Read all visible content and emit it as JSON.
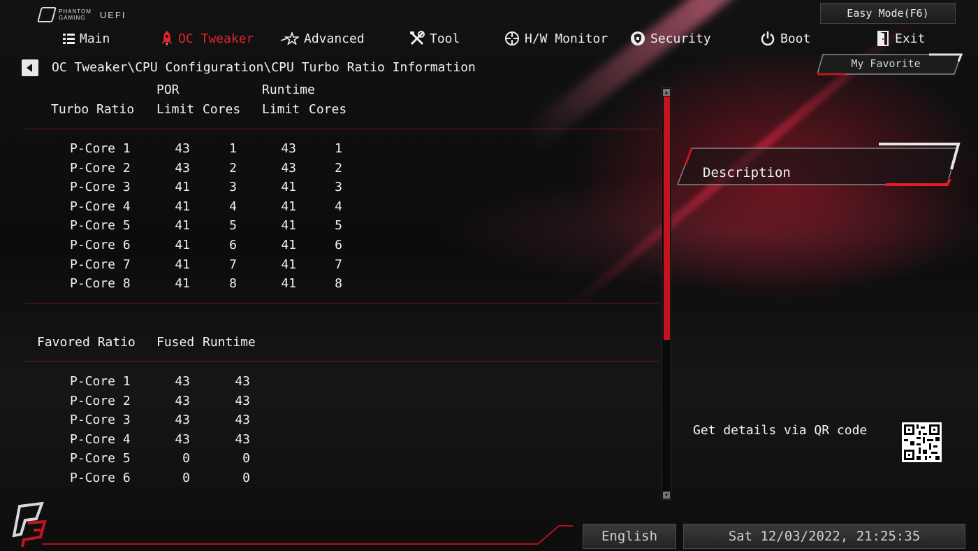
{
  "header": {
    "logo_line1": "PHANTOM",
    "logo_line2": "GAMING",
    "logo_uefi": "UEFI",
    "easy_mode": "Easy Mode(F6)"
  },
  "nav": {
    "tabs": [
      {
        "label": "Main",
        "icon": "list-icon"
      },
      {
        "label": "OC Tweaker",
        "icon": "rocket-icon",
        "active": true
      },
      {
        "label": "Advanced",
        "icon": "star-icon"
      },
      {
        "label": "Tool",
        "icon": "tools-icon"
      },
      {
        "label": "H/W Monitor",
        "icon": "crosshair-icon"
      },
      {
        "label": "Security",
        "icon": "shield-icon"
      },
      {
        "label": "Boot",
        "icon": "power-icon"
      },
      {
        "label": "Exit",
        "icon": "door-icon"
      }
    ]
  },
  "breadcrumb": "OC Tweaker\\CPU Configuration\\CPU Turbo Ratio Information",
  "favorite": "My Favorite",
  "turbo": {
    "group_por": "POR",
    "group_runtime": "Runtime",
    "col_name": "Turbo Ratio",
    "col_limit": "Limit",
    "col_cores": "Cores",
    "col_limit2": "Limit",
    "col_cores2": "Cores",
    "rows": [
      {
        "name": "P-Core 1",
        "por_limit": "43",
        "por_cores": "1",
        "rt_limit": "43",
        "rt_cores": "1"
      },
      {
        "name": "P-Core 2",
        "por_limit": "43",
        "por_cores": "2",
        "rt_limit": "43",
        "rt_cores": "2"
      },
      {
        "name": "P-Core 3",
        "por_limit": "41",
        "por_cores": "3",
        "rt_limit": "41",
        "rt_cores": "3"
      },
      {
        "name": "P-Core 4",
        "por_limit": "41",
        "por_cores": "4",
        "rt_limit": "41",
        "rt_cores": "4"
      },
      {
        "name": "P-Core 5",
        "por_limit": "41",
        "por_cores": "5",
        "rt_limit": "41",
        "rt_cores": "5"
      },
      {
        "name": "P-Core 6",
        "por_limit": "41",
        "por_cores": "6",
        "rt_limit": "41",
        "rt_cores": "6"
      },
      {
        "name": "P-Core 7",
        "por_limit": "41",
        "por_cores": "7",
        "rt_limit": "41",
        "rt_cores": "7"
      },
      {
        "name": "P-Core 8",
        "por_limit": "41",
        "por_cores": "8",
        "rt_limit": "41",
        "rt_cores": "8"
      }
    ]
  },
  "favored": {
    "col_name": "Favored Ratio",
    "col_fused": "Fused",
    "col_runtime": "Runtime",
    "rows": [
      {
        "name": "P-Core 1",
        "fused": "43",
        "runtime": "43"
      },
      {
        "name": "P-Core 2",
        "fused": "43",
        "runtime": "43"
      },
      {
        "name": "P-Core 3",
        "fused": "43",
        "runtime": "43"
      },
      {
        "name": "P-Core 4",
        "fused": "43",
        "runtime": "43"
      },
      {
        "name": "P-Core 5",
        "fused": "0",
        "runtime": "0"
      },
      {
        "name": "P-Core 6",
        "fused": "0",
        "runtime": "0"
      }
    ]
  },
  "description": {
    "title": "Description",
    "qr_text": "Get details via QR code"
  },
  "footer": {
    "language": "English",
    "datetime": "Sat 12/03/2022, 21:25:35"
  },
  "colors": {
    "accent": "#e3242b",
    "divider": "#6b1a20",
    "scroll_thumb": "#c4151e"
  }
}
